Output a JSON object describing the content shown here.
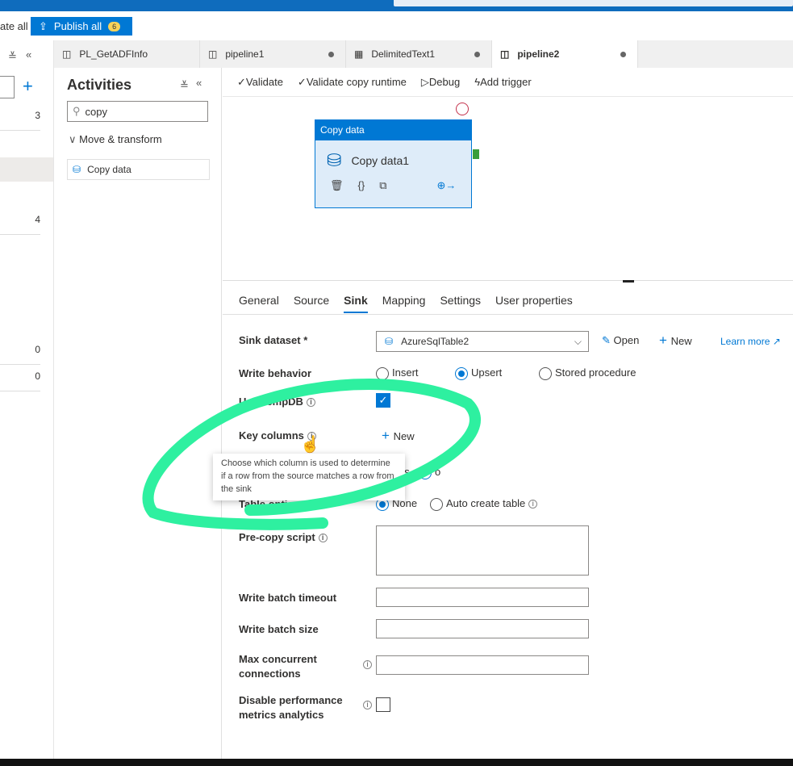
{
  "toolbar": {
    "validate_all": "ate all",
    "publish_all": "Publish all",
    "publish_count": "6"
  },
  "tabs": [
    {
      "label": "PL_GetADFInfo",
      "dirty": false
    },
    {
      "label": "pipeline1",
      "dirty": true
    },
    {
      "label": "DelimitedText1",
      "dirty": true
    },
    {
      "label": "pipeline2",
      "dirty": true,
      "active": true
    }
  ],
  "left_panel": {
    "counts": [
      "3",
      "4",
      "0",
      "0"
    ]
  },
  "activities": {
    "title": "Activities",
    "search_value": "copy",
    "group": "Move & transform",
    "item": "Copy data"
  },
  "commands": {
    "validate": "Validate",
    "validate_runtime": "Validate copy runtime",
    "debug": "Debug",
    "add_trigger": "Add trigger"
  },
  "node": {
    "type": "Copy data",
    "name": "Copy data1"
  },
  "prop_tabs": [
    "General",
    "Source",
    "Sink",
    "Mapping",
    "Settings",
    "User properties"
  ],
  "sink": {
    "dataset_label": "Sink dataset *",
    "dataset_value": "AzureSqlTable2",
    "open": "Open",
    "new": "New",
    "learn_more": "Learn more",
    "write_behavior_label": "Write behavior",
    "write_options": [
      "Insert",
      "Upsert",
      "Stored procedure"
    ],
    "write_selected": "Upsert",
    "tempdb_label": "Use TempDB",
    "tempdb_checked": true,
    "key_columns_label": "Key columns",
    "key_new": "New",
    "hidden_row_options": [
      "es",
      "o"
    ],
    "table_option_label": "Table option",
    "table_options": [
      "None",
      "Auto create table"
    ],
    "table_selected": "None",
    "precopy_label": "Pre-copy script",
    "batch_timeout_label": "Write batch timeout",
    "batch_size_label": "Write batch size",
    "max_conn_label": "Max concurrent connections",
    "disable_perf_label": "Disable performance metrics analytics",
    "disable_perf_checked": false
  },
  "tooltip": "Choose which column is used to determine if a row from the source matches a row from the sink",
  "colors": {
    "accent": "#0078d4",
    "annotation": "#2ef0a0"
  }
}
